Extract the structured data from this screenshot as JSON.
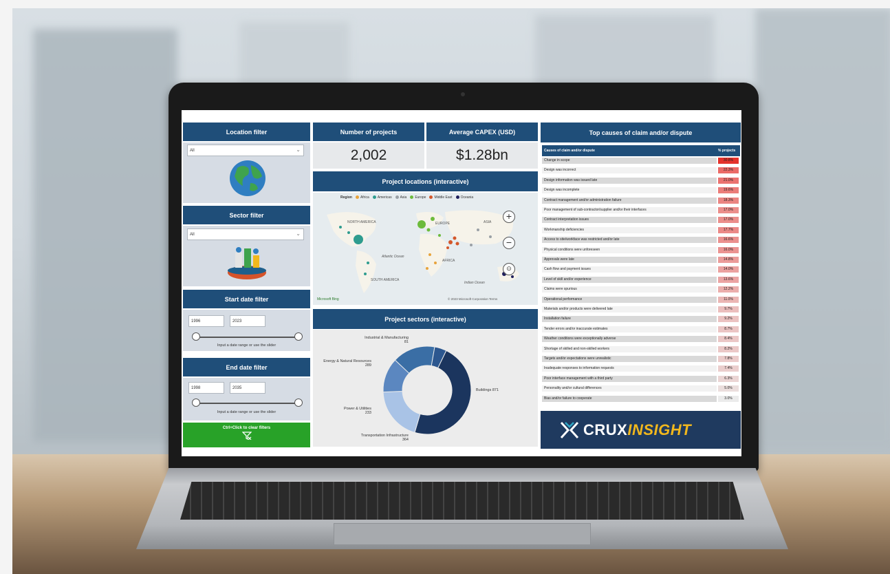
{
  "location_filter": {
    "title": "Location filter",
    "value": "All"
  },
  "sector_filter": {
    "title": "Sector filter",
    "value": "All"
  },
  "start_date_filter": {
    "title": "Start date filter",
    "from": "1996",
    "to": "2023",
    "hint": "Input a date range or use the slider"
  },
  "end_date_filter": {
    "title": "End date filter",
    "from": "1998",
    "to": "2035",
    "hint": "Input a date range or use the slider"
  },
  "clear_filters": {
    "label": "Ctrl+Click to clear filters"
  },
  "kpis": {
    "projects_title": "Number of projects",
    "projects_value": "2,002",
    "capex_title": "Average CAPEX (USD)",
    "capex_value": "$1.28bn"
  },
  "map": {
    "title": "Project locations (interactive)",
    "legend_title": "Region",
    "legend": [
      {
        "label": "Africa",
        "color": "#e8a33c"
      },
      {
        "label": "Americas",
        "color": "#2e9c8f"
      },
      {
        "label": "Asia",
        "color": "#9aa0a6"
      },
      {
        "label": "Europe",
        "color": "#6dbb3c"
      },
      {
        "label": "Middle East",
        "color": "#d4572a"
      },
      {
        "label": "Oceania",
        "color": "#1f1f5c"
      }
    ],
    "labels": [
      "NORTH AMERICA",
      "EUROPE",
      "ASIA",
      "AFRICA",
      "SOUTH AMERICA",
      "Atlantic Ocean",
      "Indian Ocean"
    ],
    "attribution": "© 2023 Microsoft Corporation  Terms",
    "bing": "Microsoft Bing"
  },
  "sectors": {
    "title": "Project sectors (interactive)",
    "chart_data": {
      "type": "pie",
      "categories": [
        "Buildings",
        "Transportation Infrastructure",
        "Power & Utilities",
        "Energy & Natural Resources",
        "Industrial & Manufacturing"
      ],
      "values": [
        871,
        364,
        233,
        289,
        81
      ],
      "colors": [
        "#1b355e",
        "#a9c3e6",
        "#5b87c0",
        "#3a6ea5",
        "#2c578f"
      ]
    },
    "labels": {
      "buildings": "Buildings 871",
      "transport": "Transportation Infrastructure",
      "transport_val": "364",
      "power": "Power & Utilities",
      "power_val": "233",
      "energy": "Energy & Natural Resources",
      "energy_val": "289",
      "industrial": "Industrial & Manufacturing",
      "industrial_val": "81"
    }
  },
  "causes": {
    "title": "Top causes of claim and/or dispute",
    "col_cause": "Causes of claim and/or dispute",
    "col_pct": "% projects",
    "rows": [
      {
        "cause": "Change in scope",
        "pct": "30.8%"
      },
      {
        "cause": "Design was incorrect",
        "pct": "22.3%"
      },
      {
        "cause": "Design information was issued late",
        "pct": "21.0%"
      },
      {
        "cause": "Design was incomplete",
        "pct": "19.6%"
      },
      {
        "cause": "Contract management and/or administration failure",
        "pct": "18.3%"
      },
      {
        "cause": "Poor management of sub-contractor/supplier and/or their interfaces",
        "pct": "17.0%"
      },
      {
        "cause": "Contract interpretation issues",
        "pct": "17.0%"
      },
      {
        "cause": "Workmanship deficiencies",
        "pct": "17.7%"
      },
      {
        "cause": "Access to site/workface was restricted and/or late",
        "pct": "16.6%"
      },
      {
        "cause": "Physical conditions were unforeseen",
        "pct": "16.0%"
      },
      {
        "cause": "Approvals were late",
        "pct": "14.8%"
      },
      {
        "cause": "Cash flow and payment issues",
        "pct": "14.0%"
      },
      {
        "cause": "Level of skill and/or experience",
        "pct": "13.6%"
      },
      {
        "cause": "Claims were spurious",
        "pct": "12.2%"
      },
      {
        "cause": "Operational performance",
        "pct": "11.0%"
      },
      {
        "cause": "Materials and/or products were delivered late",
        "pct": "9.7%"
      },
      {
        "cause": "Installation failure",
        "pct": "9.2%"
      },
      {
        "cause": "Tender errors and/or inaccurate estimates",
        "pct": "8.7%"
      },
      {
        "cause": "Weather conditions were exceptionally adverse",
        "pct": "8.4%"
      },
      {
        "cause": "Shortage of skilled and non-skilled workers",
        "pct": "8.2%"
      },
      {
        "cause": "Targets and/or expectations were unrealistic",
        "pct": "7.8%"
      },
      {
        "cause": "Inadequate responses to information requests",
        "pct": "7.4%"
      },
      {
        "cause": "Poor interface management with a third party",
        "pct": "6.3%"
      },
      {
        "cause": "Personality and/or cultural differences",
        "pct": "5.0%"
      },
      {
        "cause": "Bias and/or failure to cooperate",
        "pct": "3.0%"
      }
    ]
  },
  "logo": {
    "crux": "CRUX",
    "insight": "INSIGHT"
  },
  "colors": {
    "header": "#1f4e79",
    "panel": "#d6dce4",
    "accent_green": "#28a228",
    "highlight_red": "#e4322b",
    "logo_yellow": "#f2b81d"
  }
}
